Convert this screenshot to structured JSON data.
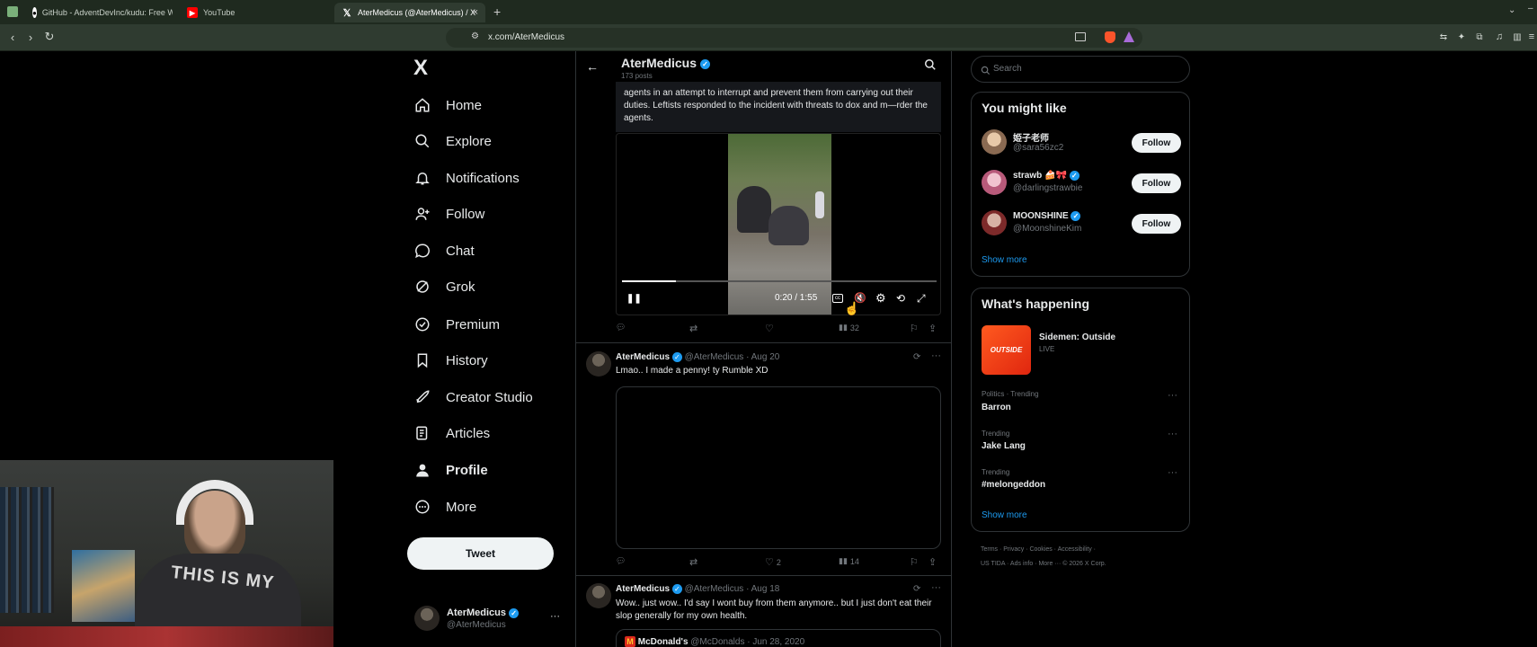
{
  "browser": {
    "tabs": [
      {
        "title": "GitHub - AdventDevInc/kudu: Free W",
        "icon": "github-icon"
      },
      {
        "title": "YouTube",
        "icon": "youtube-icon"
      },
      {
        "title": "AterMedicus (@AterMedicus) / X",
        "icon": "x-icon",
        "active": true
      }
    ],
    "url": "x.com/AterMedicus"
  },
  "nav": {
    "logo": "X",
    "items": [
      {
        "label": "Home",
        "icon": "home-icon"
      },
      {
        "label": "Explore",
        "icon": "search-icon"
      },
      {
        "label": "Notifications",
        "icon": "bell-icon"
      },
      {
        "label": "Follow",
        "icon": "person-add-icon"
      },
      {
        "label": "Chat",
        "icon": "chat-icon"
      },
      {
        "label": "Grok",
        "icon": "grok-icon"
      },
      {
        "label": "Premium",
        "icon": "premium-icon"
      },
      {
        "label": "History",
        "icon": "bookmark-icon"
      },
      {
        "label": "Creator Studio",
        "icon": "rocket-icon"
      },
      {
        "label": "Articles",
        "icon": "articles-icon"
      },
      {
        "label": "Profile",
        "icon": "person-icon"
      },
      {
        "label": "More",
        "icon": "more-circle-icon"
      }
    ],
    "tweet_label": "Tweet",
    "account": {
      "name": "AterMedicus",
      "handle": "@AterMedicus",
      "more": "···"
    }
  },
  "profile_header": {
    "name": "AterMedicus",
    "posts": "173 posts"
  },
  "tweets": [
    {
      "text": "agents in an attempt to interrupt and prevent them from carrying out their duties. Leftists responded to the incident with threats to dox and m—rder the agents.",
      "video": {
        "time": "0:20 / 1:55",
        "progress": 0.17
      },
      "views": "32"
    },
    {
      "name": "AterMedicus",
      "handle": "@AterMedicus · Aug 20",
      "text": "Lmao.. I made a penny! ty Rumble XD",
      "likes": "2",
      "views": "14"
    },
    {
      "name": "AterMedicus",
      "handle": "@AterMedicus · Aug 18",
      "text": "Wow.. just wow.. I'd say I wont buy from them anymore.. but I just don't eat their slop generally for my own health.",
      "quote": {
        "name": "McDonald's",
        "handle": "@McDonalds · Jun 28, 2020"
      }
    }
  ],
  "sidebar": {
    "search_placeholder": "Search",
    "might_like_title": "You might like",
    "suggestions": [
      {
        "name": "姫子老师",
        "handle": "@sara56zc2",
        "follow": "Follow"
      },
      {
        "name": "strawb 🍰🎀",
        "handle": "@darlingstrawbie",
        "follow": "Follow"
      },
      {
        "name": "MOONSHINE",
        "handle": "@MoonshineKim",
        "follow": "Follow"
      }
    ],
    "show_more": "Show more",
    "happening_title": "What's happening",
    "live": {
      "title": "Sidemen: Outside",
      "status": "LIVE",
      "thumb": "OUTSIDE"
    },
    "trends": [
      {
        "category": "Politics · Trending",
        "name": "Barron"
      },
      {
        "category": "Trending",
        "name": "Jake Lang"
      },
      {
        "category": "Trending",
        "name": "#melongeddon"
      }
    ],
    "show_more_2": "Show more",
    "footer": [
      "Terms · Privacy · Cookies · Accessibility ·",
      "US TIDA · Ads info · More ··· © 2026 X Corp."
    ]
  },
  "webcam": {
    "shirt_text": "THIS IS MY"
  }
}
